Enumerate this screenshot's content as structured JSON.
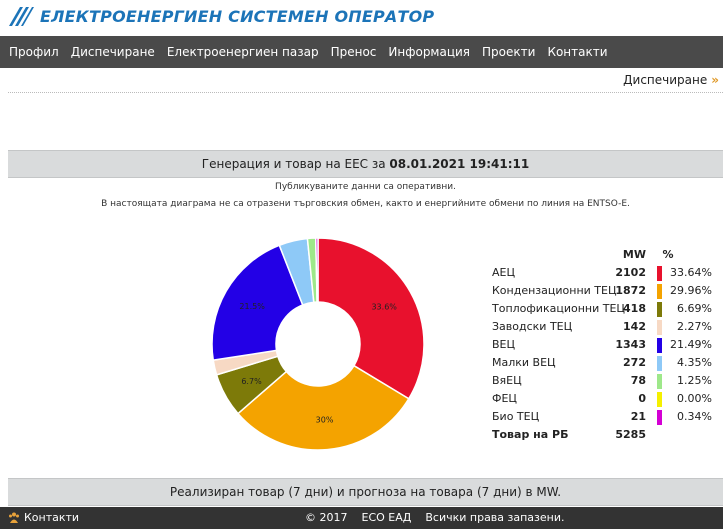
{
  "header": {
    "logo_text": "ЕЛЕКТРОЕНЕРГИЕН СИСТЕМЕН ОПЕРАТОР",
    "brand_color": "#1c74b8"
  },
  "nav": {
    "items": [
      "Профил",
      "Диспечиране",
      "Електроенергиен пазар",
      "Пренос",
      "Информация",
      "Проекти",
      "Контакти"
    ]
  },
  "breadcrumb": {
    "label": "Диспечиране",
    "arrow": "»"
  },
  "panel": {
    "title_prefix": "Генерация и товар на ЕЕС за",
    "datetime": "08.01.2021 19:41:11",
    "note1": "Публикуваните данни са оперативни.",
    "note2": "В настоящата диаграма не са отразени търговския обмен, както и енергийните обмени по линия на ENTSO-E."
  },
  "table": {
    "col_mw": "MW",
    "col_pct": "%",
    "total_label": "Товар на РБ",
    "total_mw": "5285"
  },
  "chart_data": {
    "type": "pie",
    "title": "",
    "slices": [
      {
        "name": "АЕЦ",
        "mw": "2102",
        "percent": "33.64%",
        "value": 33.64,
        "color": "#e8112d",
        "label": "33.6%"
      },
      {
        "name": "Кондензационни ТЕЦ",
        "mw": "1872",
        "percent": "29.96%",
        "value": 29.96,
        "color": "#f4a300",
        "label": "30%"
      },
      {
        "name": "Топлофикационни ТЕЦ",
        "mw": "418",
        "percent": "6.69%",
        "value": 6.69,
        "color": "#7d7a09",
        "label": "6.7%"
      },
      {
        "name": "Заводски ТЕЦ",
        "mw": "142",
        "percent": "2.27%",
        "value": 2.27,
        "color": "#f7d9c4",
        "label": ""
      },
      {
        "name": "ВЕЦ",
        "mw": "1343",
        "percent": "21.49%",
        "value": 21.49,
        "color": "#2300e6",
        "label": "21.5%"
      },
      {
        "name": "Малки ВЕЦ",
        "mw": "272",
        "percent": "4.35%",
        "value": 4.35,
        "color": "#8ec9f7",
        "label": ""
      },
      {
        "name": "ВяЕЦ",
        "mw": "78",
        "percent": "1.25%",
        "value": 1.25,
        "color": "#9ee88a",
        "label": ""
      },
      {
        "name": "ФЕЦ",
        "mw": "0",
        "percent": "0.00%",
        "value": 0.0,
        "color": "#f5f000",
        "label": ""
      },
      {
        "name": "Био ТЕЦ",
        "mw": "21",
        "percent": "0.34%",
        "value": 0.34,
        "color": "#d400d4",
        "label": ""
      }
    ]
  },
  "panel_foot": {
    "title": "Реализиран товар (7 дни) и прогноза на товара (7 дни) в MW."
  },
  "footer": {
    "contacts": "Контакти",
    "copyright": "© 2017",
    "company": "ЕСО ЕАД",
    "rights": "Всички права запазени."
  }
}
